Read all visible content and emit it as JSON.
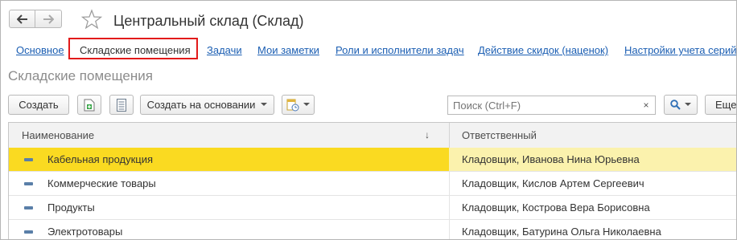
{
  "header": {
    "back_icon": "arrow-left-icon",
    "forward_icon": "arrow-right-icon",
    "favorite_icon": "star-icon",
    "title": "Центральный склад (Склад)"
  },
  "tabs": [
    {
      "label": "Основное"
    },
    {
      "label": "Складские помещения",
      "active": true
    },
    {
      "label": "Задачи"
    },
    {
      "label": "Мои заметки"
    },
    {
      "label": "Роли и исполнители задач"
    },
    {
      "label": "Действие скидок (наценок)"
    },
    {
      "label": "Настройки учета серий"
    }
  ],
  "section": {
    "title": "Складские помещения"
  },
  "toolbar": {
    "create_label": "Создать",
    "create_based_label": "Создать на основании",
    "search_placeholder": "Поиск (Ctrl+F)",
    "clear_label": "×",
    "more_label": "Еще"
  },
  "table": {
    "columns": [
      "Наименование",
      "Ответственный"
    ],
    "sort_indicator": "↓",
    "rows": [
      {
        "name": "Кабельная продукция",
        "responsible": "Кладовщик, Иванова Нина Юрьевна",
        "selected": true
      },
      {
        "name": "Коммерческие товары",
        "responsible": "Кладовщик, Кислов Артем Сергеевич"
      },
      {
        "name": "Продукты",
        "responsible": "Кладовщик, Кострова Вера Борисовна"
      },
      {
        "name": "Электротовары",
        "responsible": "Кладовщик, Батурина Ольга Николаевна"
      }
    ]
  },
  "colors": {
    "link": "#1c5fb3",
    "selected_row": "#fada21",
    "selected_row_tail": "#fbf2ad",
    "highlight_border": "#e21a1a"
  }
}
